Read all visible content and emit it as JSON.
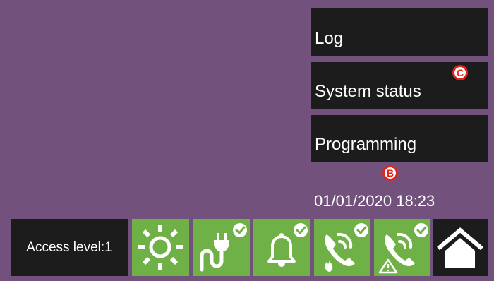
{
  "menu": {
    "log_label": "Log",
    "system_status_label": "System status",
    "programming_label": "Programming"
  },
  "badges": {
    "c_label": "C",
    "b_label": "B"
  },
  "status": {
    "datetime": "01/01/2020 18:23",
    "access_level": "Access level:1"
  },
  "status_tiles": [
    {
      "icon": "sun-icon",
      "ok": false
    },
    {
      "icon": "power-plug-icon",
      "ok": true
    },
    {
      "icon": "bell-icon",
      "ok": true
    },
    {
      "icon": "phone-fire-icon",
      "ok": true
    },
    {
      "icon": "phone-fault-icon",
      "ok": true
    }
  ],
  "colors": {
    "background": "#72527c",
    "panel": "#1c1c1c",
    "tile_ok": "#6fb146",
    "badge_accent": "#e32219"
  }
}
